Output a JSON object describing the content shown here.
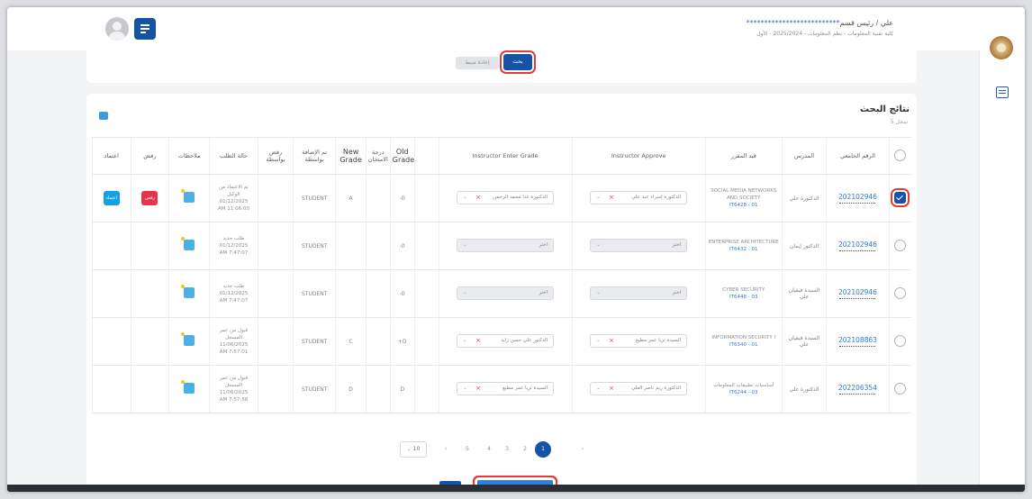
{
  "header": {
    "user_stars": "**************************",
    "user_name": "علي / رئيس قسم",
    "context": "كلية تقنية المعلومات - نظم المعلومات - 2025/2024 - الأول"
  },
  "filter": {
    "search_label": "بحث",
    "reset_label": "إعادة ضبط"
  },
  "results": {
    "title": "نتائج البحث",
    "count": "5 سجل"
  },
  "table": {
    "headers": {
      "student_id": "الرقم الجامعي",
      "teacher": "المدرس",
      "course": "قيد المقرر",
      "instructor_approve": "Instructor Approve",
      "instructor_enter_grade": "Instructor Enter Grade",
      "old_grade": "Old Grade",
      "exam_grade": "درجة الامتحان",
      "new_grade": "New Grade",
      "added_by": "تم الإضافة بواسطة",
      "rejected_by": "رفض بواسطة",
      "request_status": "حالة الطلب",
      "notes": "ملاحظات",
      "reject": "رفض",
      "approve": "اعتماد"
    },
    "rows": [
      {
        "checked": true,
        "student_id": "202102946",
        "teacher": "الدكتورة علي",
        "course_name": "SOCIAL MEDIA NETWORKS AND SOCIETY",
        "course_code": "IT6428 - 01",
        "approve_name": "الدكتورة إسراء عبد علي",
        "approve_disabled": false,
        "grade_name": "الدكتورة غدا محمد الرحمن",
        "grade_disabled": false,
        "old_grade": "-0",
        "new_grade": "A",
        "added_by": "STUDENT",
        "status_text": "تم الاعتماد من الوكيل",
        "status_date": "01/12/2025",
        "status_time": "AM 11:06:00",
        "has_actions": true
      },
      {
        "checked": false,
        "student_id": "202102946",
        "teacher": "الدكتور إيمان",
        "course_name": "ENTERPRISE ARCHITECTURE",
        "course_code": "IT6432 - 01",
        "approve_name": "اختر",
        "approve_disabled": true,
        "grade_name": "اختر",
        "grade_disabled": true,
        "old_grade": "-0",
        "new_grade": "",
        "added_by": "STUDENT",
        "status_text": "طلب جديد",
        "status_date": "01/12/2025",
        "status_time": "AM 7:47:07",
        "has_actions": false
      },
      {
        "checked": false,
        "student_id": "202102946",
        "teacher": "السيدة فيفيان علي",
        "course_name": "CYBER SECURITY",
        "course_code": "IT6448 - 03",
        "approve_name": "اختر",
        "approve_disabled": true,
        "grade_name": "اختر",
        "grade_disabled": true,
        "old_grade": "-0",
        "new_grade": "",
        "added_by": "STUDENT",
        "status_text": "طلب جديد",
        "status_date": "01/12/2025",
        "status_time": "AM 7:47:07",
        "has_actions": false
      },
      {
        "checked": false,
        "student_id": "202108863",
        "teacher": "السيدة فيفيان علي",
        "course_name": "INFORMATION SECURITY I",
        "course_code": "IT6340 - 01",
        "approve_name": "السيدة ثريا عمر مطيع",
        "approve_disabled": false,
        "grade_name": "الدكتور علي حسن زايد",
        "grade_disabled": false,
        "old_grade": "+D",
        "new_grade": "C",
        "added_by": "STUDENT",
        "status_text": "قبول من عمر المسجل",
        "status_date": "11/06/2025",
        "status_time": "AM 7:57:01",
        "has_actions": false
      },
      {
        "checked": false,
        "student_id": "202206354",
        "teacher": "الدكتورة علي",
        "course_name": "أساسيات تطبيقات المعلومات",
        "course_code": "IT6244 - 03",
        "approve_name": "الدكتورة ريم ناصر العلي",
        "approve_disabled": false,
        "grade_name": "السيدة ثريا عمر مطيع",
        "grade_disabled": false,
        "old_grade": "D",
        "new_grade": "D",
        "added_by": "STUDENT",
        "status_text": "قبول من عمر المسجل",
        "status_date": "11/06/2025",
        "status_time": "AM 7:57:58",
        "has_actions": false
      }
    ],
    "reject_label": "رفض",
    "approve_label": "اعتماد"
  },
  "pagination": {
    "page_size": "10",
    "pages": [
      "1",
      "2",
      "3",
      "4",
      "5"
    ],
    "active_page": "1"
  },
  "footer": {
    "small_button": "إلغاء",
    "approve_all_label": "Approve All Selected"
  }
}
